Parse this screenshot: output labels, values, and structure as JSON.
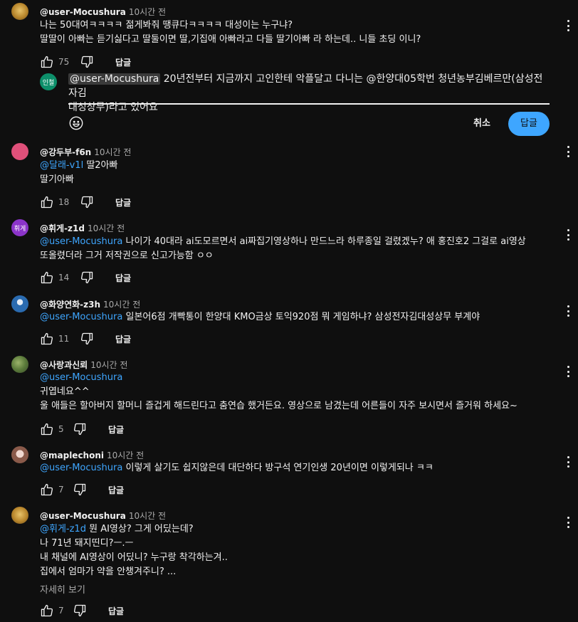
{
  "comments": [
    {
      "author": "@user-Mocushura",
      "time": "10시간 전",
      "lines": [
        {
          "mention": "",
          "text": "나는 50대여ㅋㅋㅋㅋ 젊게봐줘 땡큐다ㅋㅋㅋㅋ 대성이는 누구냐?"
        },
        {
          "mention": "",
          "text": "딸딸이 아빠는 듣기싫다고 딸둘이면 딸,기집애 아빠라고 다들 딸기아빠 라 하는데.. 니들 초딩 이니?"
        }
      ],
      "likes": "75",
      "reply_label": "답글"
    },
    {
      "author": "@강두부-f6n",
      "time": "10시간 전",
      "lines": [
        {
          "mention": "@달래-v1l",
          "text": "딸2아빠"
        },
        {
          "mention": "",
          "text": "딸기아빠"
        }
      ],
      "likes": "18",
      "reply_label": "답글"
    },
    {
      "author": "@휘게-z1d",
      "avatar_text": "휘게",
      "time": "10시간 전",
      "lines": [
        {
          "mention": "@user-Mocushura",
          "text": "나이가 40대라 ai도모르면서 ai짜집기영상하나 만드느라 하루종일 걸렸겠누? 애 홍진호2 그걸로 ai영상"
        },
        {
          "mention": "",
          "text": "또올렸더라 그거 저작권으로 신고가능함 ㅇㅇ"
        }
      ],
      "likes": "14",
      "reply_label": "답글"
    },
    {
      "author": "@화양연화-z3h",
      "time": "10시간 전",
      "lines": [
        {
          "mention": "@user-Mocushura",
          "text": "일본어6점 개빡통이 한양대 KMO금상 토익920점 뭐 게임하냐? 삼성전자김대성상무 부계야"
        }
      ],
      "likes": "11",
      "reply_label": "답글"
    },
    {
      "author": "@사랑과신뢰",
      "time": "10시간 전",
      "lines": [
        {
          "mention": "@user-Mocushura",
          "text": ""
        },
        {
          "mention": "",
          "text": "귀엽네요^^"
        },
        {
          "mention": "",
          "text": "울 애들은 할아버지 할머니 즐겁게 해드린다고 춤연습 했거든요. 영상으로 남겼는데 어른들이 자주 보시면서 즐거워 하세요~"
        }
      ],
      "likes": "5",
      "reply_label": "답글"
    },
    {
      "author": "@maplechoni",
      "time": "10시간 전",
      "lines": [
        {
          "mention": "@user-Mocushura",
          "text": "이렇게 살기도 쉽지않은데 대단하다 방구석 연기인생 20년이면 이렇게되나 ㅋㅋ"
        }
      ],
      "likes": "7",
      "reply_label": "답글"
    },
    {
      "author": "@user-Mocushura",
      "time": "10시간 전",
      "lines": [
        {
          "mention": "@휘게-z1d",
          "text": "뭔 AI영상? 그게 어딨는데?"
        },
        {
          "mention": "",
          "text": "나 71년 돼지띤디?ㅡ.ㅡ"
        },
        {
          "mention": "",
          "text": "내 채널에 AI영상이 어딨니? 누구랑 착각하는겨.."
        },
        {
          "mention": "",
          "text": "집에서 엄마가 약을 안챙겨주니? ..."
        }
      ],
      "likes": "7",
      "reply_label": "답글",
      "show_more": "자세히 보기"
    }
  ],
  "reply_box": {
    "avatar_text": "인철",
    "tag": "@user-Mocushura",
    "line1": "20년전부터 지금까지 고인한테 악플달고 다니는 @한양대05학번 청년농부김베르만(삼성전자김",
    "line2": "대성상무)라고 있어요",
    "cancel_label": "취소",
    "submit_label": "답글"
  },
  "colors": {
    "mention": "#3ea6ff",
    "background": "#0f0f0f",
    "submit": "#3ea6ff"
  }
}
